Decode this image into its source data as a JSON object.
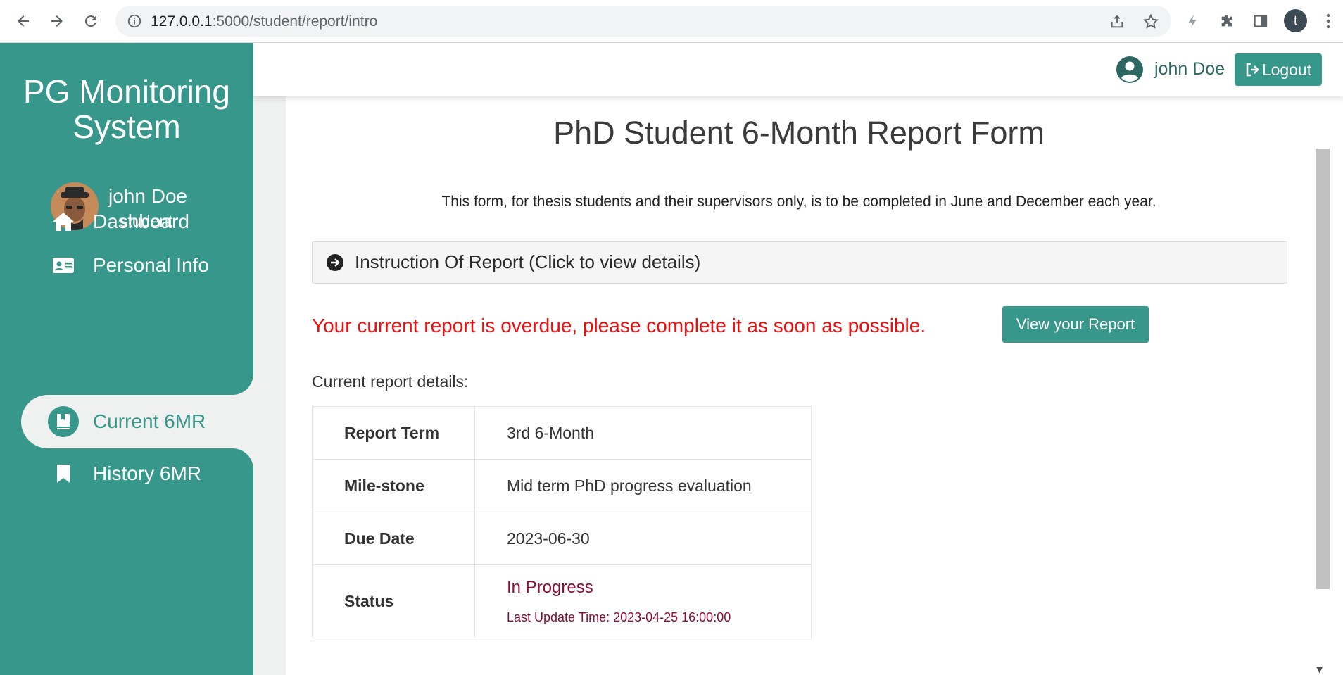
{
  "browser": {
    "url_host": "127.0.0.1",
    "url_rest": ":5000/student/report/intro",
    "profile_initial": "t"
  },
  "sidebar": {
    "brand": "PG Monitoring System",
    "user_name": "john Doe",
    "user_role": "student",
    "items": [
      {
        "label": "Dashboard",
        "icon": "home-icon"
      },
      {
        "label": "Personal Info",
        "icon": "id-card-icon"
      },
      {
        "label": "Current 6MR",
        "icon": "book-icon"
      },
      {
        "label": "History 6MR",
        "icon": "bookmark-icon"
      }
    ]
  },
  "topbar": {
    "user_name": "john Doe",
    "logout_label": "Logout"
  },
  "main": {
    "title": "PhD Student 6-Month Report Form",
    "subtitle": "This form, for thesis students and their supervisors only, is to be completed in June and December each year.",
    "accordion_label": "Instruction Of Report (Click to view details)",
    "overdue_message": "Your current report is overdue, please complete it as soon as possible.",
    "view_report_label": "View your Report",
    "details_label": "Current report details:",
    "details": {
      "term_key": "Report Term",
      "term_value": "3rd 6-Month",
      "milestone_key": "Mile-stone",
      "milestone_value": "Mid term PhD progress evaluation",
      "due_key": "Due Date",
      "due_value": "2023-06-30",
      "status_key": "Status",
      "status_value": "In Progress",
      "last_update": "Last Update Time: 2023-04-25 16:00:00"
    }
  },
  "colors": {
    "accent": "#36978a",
    "overdue": "#f20d0d",
    "status": "#8a1033"
  }
}
